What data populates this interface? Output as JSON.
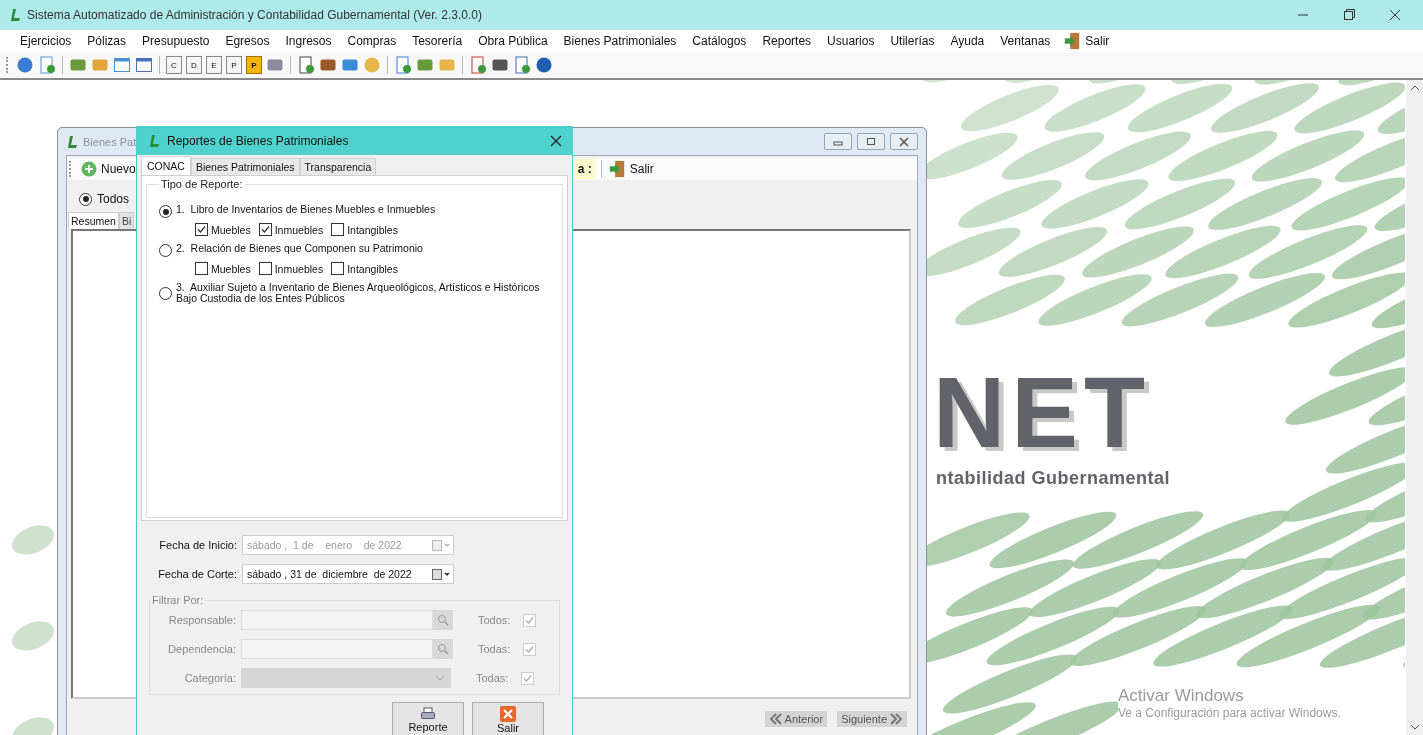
{
  "window": {
    "title": "Sistema Automatizado de Administración y Contabilidad Gubernamental  (Ver. 2.3.0.0)"
  },
  "menu": [
    {
      "label": "Ejercicios",
      "kind": "menu"
    },
    {
      "label": "Pólizas",
      "kind": "menu"
    },
    {
      "label": "Presupuesto",
      "kind": "menu"
    },
    {
      "label": "Egresos",
      "kind": "menu"
    },
    {
      "label": "Ingresos",
      "kind": "menu"
    },
    {
      "label": "Compras",
      "kind": "menu"
    },
    {
      "label": "Tesorería",
      "kind": "menu"
    },
    {
      "label": "Obra Pública",
      "kind": "menu"
    },
    {
      "label": "Bienes Patrimoniales",
      "kind": "menu"
    },
    {
      "label": "Catálogos",
      "kind": "menu"
    },
    {
      "label": "Reportes",
      "kind": "menu"
    },
    {
      "label": "Usuarios",
      "kind": "menu"
    },
    {
      "label": "Utilerías",
      "kind": "menu"
    },
    {
      "label": "Ayuda",
      "kind": "menu"
    },
    {
      "label": "Ventanas",
      "kind": "menu"
    },
    {
      "label": "Salir",
      "kind": "exit"
    }
  ],
  "toolbar_letters": [
    {
      "label": "C",
      "kind": "plain"
    },
    {
      "label": "D",
      "kind": "plain"
    },
    {
      "label": "E",
      "kind": "plain"
    },
    {
      "label": "P",
      "kind": "plain"
    },
    {
      "label": "P",
      "kind": "highlight"
    }
  ],
  "background": {
    "logo_text": "NET",
    "logo_subtitle": "ntabilidad Gubernamental"
  },
  "child_window": {
    "title": "Bienes Pat",
    "new_button": "Nuevo",
    "field_label": "a :",
    "exit_button": "Salir",
    "filter": {
      "label": "Todos",
      "selected": true
    },
    "tabs": [
      {
        "label": "Resumen",
        "selected": true
      },
      {
        "label": "Bi",
        "selected": false
      }
    ],
    "nav": [
      {
        "label": "Anterior",
        "kind": "prev"
      },
      {
        "label": "Siguiente",
        "kind": "next"
      }
    ]
  },
  "dialog": {
    "title": "Reportes de Bienes Patrimoniales",
    "tabs": [
      {
        "label": "CONAC",
        "selected": true
      },
      {
        "label": "Bienes Patrimoniales",
        "selected": false
      },
      {
        "label": "Transparencia",
        "selected": false
      }
    ],
    "group_title": "Tipo de Reporte:",
    "report_types": [
      {
        "number": "1.",
        "lines": [
          "Libro de Inventarios de Bienes Muebles e Inmuebles"
        ],
        "selected": true,
        "options": [
          {
            "label": "Muebles",
            "checked": true
          },
          {
            "label": "Inmuebles",
            "checked": true
          },
          {
            "label": "Intangibles",
            "checked": false
          }
        ]
      },
      {
        "number": "2.",
        "lines": [
          "Relación de Bienes que Componen su Patrimonio"
        ],
        "selected": false,
        "options": [
          {
            "label": "Muebles",
            "checked": false
          },
          {
            "label": "Inmuebles",
            "checked": false
          },
          {
            "label": "Intangibles",
            "checked": false
          }
        ]
      },
      {
        "number": "3.",
        "lines": [
          "Auxiliar Sujeto a Inventario de Bienes Arqueológicos, Artísticos e Históricos",
          "Bajo Custodia de los Entes Públicos"
        ],
        "selected": false
      }
    ],
    "dates": [
      {
        "label": "Fecha de Inicio:",
        "value": "sábado ,  1 de    enero    de 2022",
        "disabled": true
      },
      {
        "label": "Fecha de Corte:",
        "value": "sábado , 31 de  diciembre  de 2022",
        "disabled": false
      }
    ],
    "filter": {
      "title": "Filtrar Por:",
      "disabled": true,
      "rows": [
        {
          "label": "Responsable:",
          "kind": "lookup",
          "all_label": "Todos:",
          "checked": true
        },
        {
          "label": "Dependencia:",
          "kind": "lookup",
          "all_label": "Todas:",
          "checked": true
        },
        {
          "label": "Categoría:",
          "kind": "dropdown",
          "all_label": "Todas:",
          "checked": true
        }
      ]
    },
    "buttons": [
      {
        "label": "Reporte",
        "kind": "print"
      },
      {
        "label": "Salir",
        "kind": "close"
      }
    ]
  },
  "os_notice": {
    "title": "Activar Windows",
    "text": "Ve a Configuración para activar Windows."
  }
}
